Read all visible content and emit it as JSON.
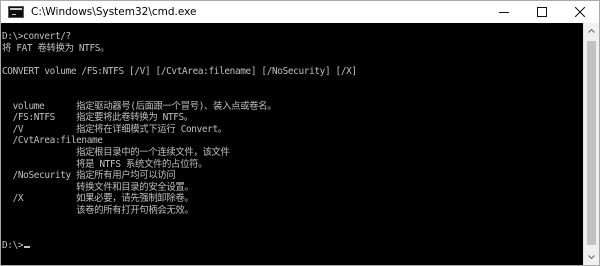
{
  "window": {
    "title": "C:\\Windows\\System32\\cmd.exe",
    "app_icon": "console-icon",
    "controls": {
      "minimize_icon": "minimize-icon",
      "maximize_icon": "maximize-icon",
      "close_icon": "close-icon"
    }
  },
  "console": {
    "foreground": "#c0c0c0",
    "background": "#000000",
    "lines": [
      "D:\\>convert/?",
      "将 FAT 卷转换为 NTFS。",
      "",
      "CONVERT volume /FS:NTFS [/V] [/CvtArea:filename] [/NoSecurity] [/X]",
      "",
      "",
      "  volume      指定驱动器号(后面跟一个冒号)、装入点或卷名。",
      "  /FS:NTFS    指定要将此卷转换为 NTFS。",
      "  /V          指定将在详细模式下运行 Convert。",
      "  /CvtArea:filename",
      "              指定根目录中的一个连续文件，该文件",
      "              将是 NTFS 系统文件的占位符。",
      "  /NoSecurity 指定所有用户均可以访问",
      "              转换文件和目录的安全设置。",
      "  /X          如果必要，请先强制卸除卷。",
      "              该卷的所有打开句柄会无效。",
      "",
      ""
    ],
    "prompt": "D:\\>"
  },
  "scrollbar": {
    "up_icon": "scroll-up-arrow-icon",
    "down_icon": "scroll-down-arrow-icon"
  }
}
